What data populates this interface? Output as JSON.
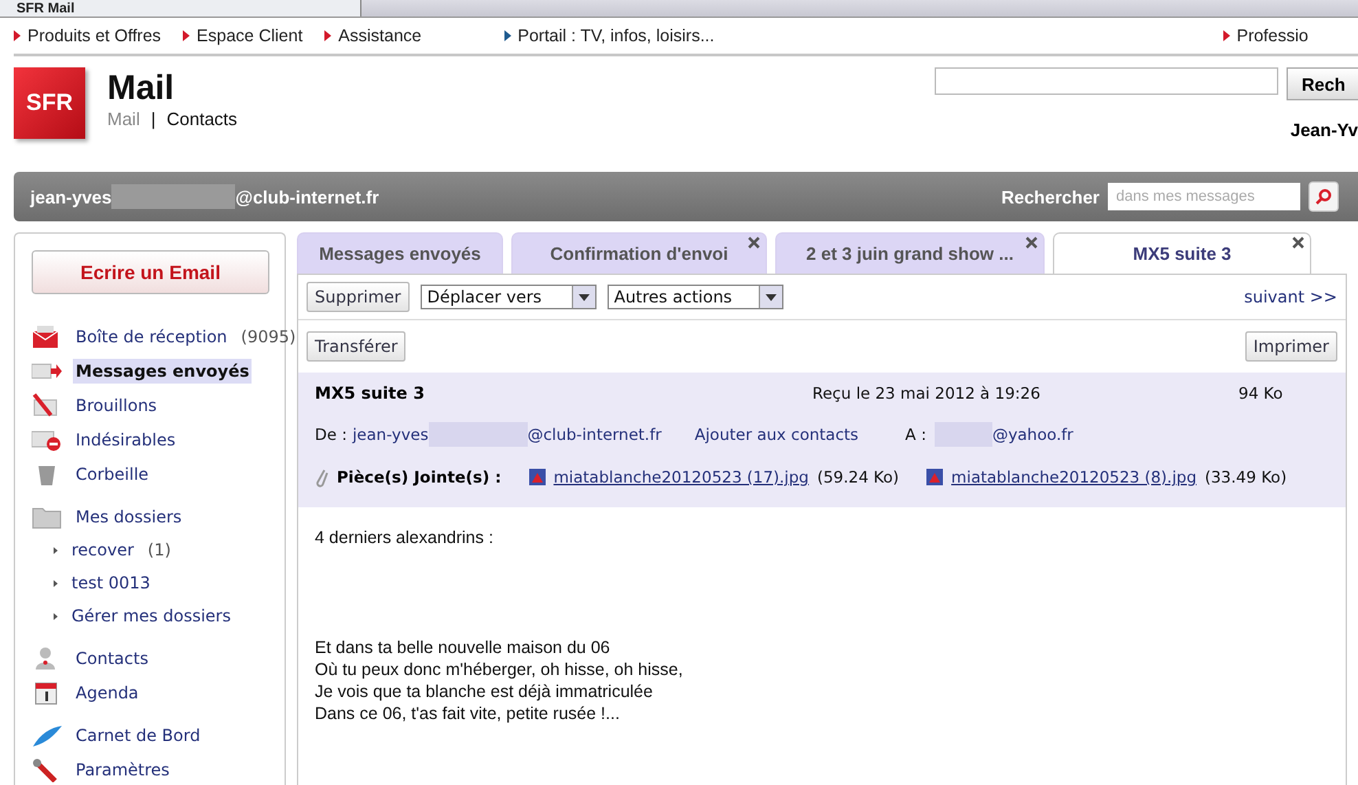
{
  "browser_tab": {
    "title": "SFR Mail"
  },
  "top_nav": [
    {
      "label": "Produits et Offres",
      "color": "#d3192b"
    },
    {
      "label": "Espace Client",
      "color": "#d3192b"
    },
    {
      "label": "Assistance",
      "color": "#d3192b"
    },
    {
      "label": "Portail : TV, infos, loisirs...",
      "color": "#1f5b8f"
    },
    {
      "label": "Professio",
      "color": "#d3192b"
    }
  ],
  "header": {
    "logo": "SFR",
    "title": "Mail",
    "links": [
      {
        "label": "Mail",
        "selected": false
      },
      {
        "label": "Contacts",
        "selected": true
      }
    ],
    "separator": "|",
    "search_button": "Rech",
    "user_name": "Jean-Yv"
  },
  "account_bar": {
    "email_start": "jean-yves",
    "email_end": "@club-internet.fr",
    "search_label": "Rechercher",
    "search_placeholder": "dans mes messages"
  },
  "sidebar": {
    "compose_button": "Ecrire un Email",
    "items": [
      {
        "label": "Boîte de réception",
        "count": "(9095)",
        "selected": false
      },
      {
        "label": "Messages envoyés",
        "selected": true
      },
      {
        "label": "Brouillons",
        "selected": false
      },
      {
        "label": "Indésirables",
        "selected": false
      },
      {
        "label": "Corbeille",
        "selected": false
      },
      {
        "label": "Mes dossiers",
        "selected": false,
        "children": [
          {
            "label": "recover",
            "count": "(1)",
            "selected": false
          },
          {
            "label": "test 0013",
            "selected": false
          },
          {
            "label": "Gérer mes dossiers",
            "selected": false
          }
        ]
      },
      {
        "label": "Contacts",
        "selected": false
      },
      {
        "label": "Agenda",
        "selected": false
      },
      {
        "label": "Carnet de Bord",
        "selected": false
      },
      {
        "label": "Paramètres",
        "selected": false
      }
    ]
  },
  "tabs": [
    {
      "label": "Messages envoyés",
      "selected": false,
      "closable": false
    },
    {
      "label": "Confirmation d'envoi",
      "selected": false,
      "closable": true
    },
    {
      "label": "2 et 3 juin grand show ...",
      "selected": false,
      "closable": true
    },
    {
      "label": "MX5 suite 3",
      "selected": true,
      "closable": true
    }
  ],
  "toolbar": {
    "delete_button": "Supprimer",
    "move_select": "Déplacer vers",
    "actions_select": "Autres actions",
    "next_link": "suivant >>",
    "forward_button": "Transférer",
    "print_button": "Imprimer"
  },
  "message": {
    "subject": "MX5 suite 3",
    "received": "Reçu le 23 mai 2012 à 19:26",
    "size": "94 Ko",
    "from_label": "De :",
    "from_start": "jean-yves",
    "from_end": "@club-internet.fr",
    "add_contact": "Ajouter aux contacts",
    "to_label": "A :",
    "to_end": "@yahoo.fr",
    "attachments_label": "Pièce(s) Jointe(s) :",
    "attachments": [
      {
        "name": "miatablanche20120523 (17).jpg",
        "size": "(59.24 Ko)"
      },
      {
        "name": "miatablanche20120523 (8).jpg",
        "size": "(33.49 Ko)"
      }
    ],
    "intro": "4 derniers alexandrins :",
    "verses": [
      "Et dans ta belle nouvelle maison du 06",
      "Où tu peux donc m'héberger, oh hisse, oh hisse,",
      "Je vois que ta blanche est déjà immatriculée",
      "Dans ce 06, t'as fait vite, petite rusée !..."
    ]
  }
}
